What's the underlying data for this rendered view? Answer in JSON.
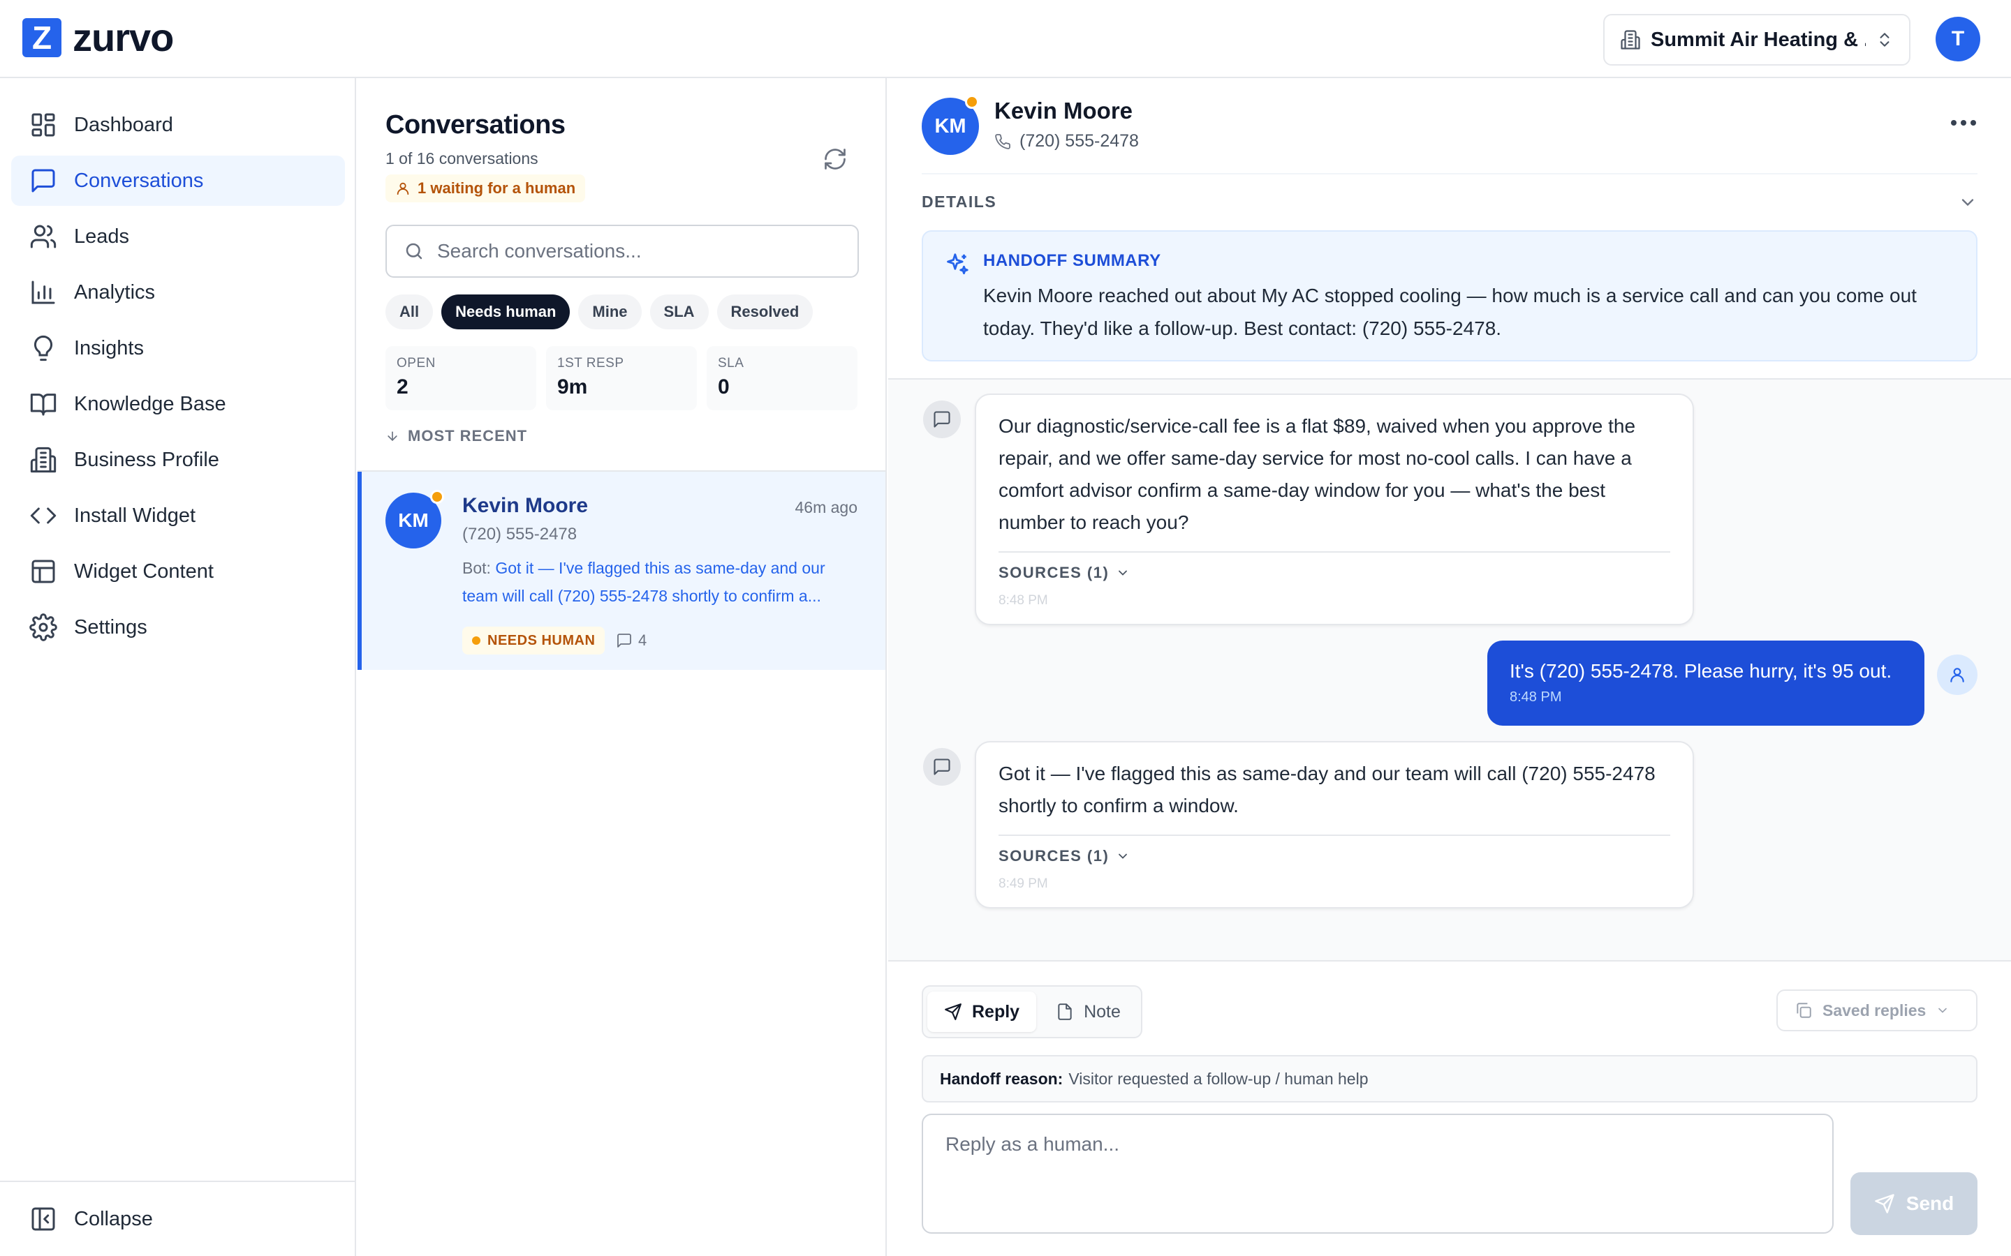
{
  "app": {
    "logo_letter": "Z",
    "logo_text": "zurvo",
    "business_name": "Summit Air Heating & ...",
    "user_initial": "T"
  },
  "sidebar": {
    "items": [
      {
        "label": "Dashboard",
        "icon": "dashboard-icon"
      },
      {
        "label": "Conversations",
        "icon": "chat-icon",
        "active": true
      },
      {
        "label": "Leads",
        "icon": "users-icon"
      },
      {
        "label": "Analytics",
        "icon": "bar-chart-icon"
      },
      {
        "label": "Insights",
        "icon": "lightbulb-icon"
      },
      {
        "label": "Knowledge Base",
        "icon": "book-icon"
      },
      {
        "label": "Business Profile",
        "icon": "building-icon"
      },
      {
        "label": "Install Widget",
        "icon": "code-icon"
      },
      {
        "label": "Widget Content",
        "icon": "layout-icon"
      },
      {
        "label": "Settings",
        "icon": "gear-icon"
      }
    ],
    "collapse_label": "Collapse"
  },
  "conversations": {
    "title": "Conversations",
    "count_text": "1 of 16 conversations",
    "waiting_text": "1 waiting for a human",
    "search_placeholder": "Search conversations...",
    "filters": [
      "All",
      "Needs human",
      "Mine",
      "SLA",
      "Resolved"
    ],
    "active_filter": "Needs human",
    "stats": [
      {
        "label": "OPEN",
        "value": "2"
      },
      {
        "label": "1ST RESP",
        "value": "9m"
      },
      {
        "label": "SLA",
        "value": "0"
      }
    ],
    "sort_label": "MOST RECENT",
    "items": [
      {
        "initials": "KM",
        "name": "Kevin Moore",
        "time": "46m ago",
        "phone": "(720) 555-2478",
        "preview_prefix": "Bot:",
        "preview_line1": "Got it — I've flagged this as same-day and our",
        "preview_line2": "team will call (720) 555-2478 shortly to confirm a...",
        "badge": "NEEDS HUMAN",
        "message_count": "4"
      }
    ]
  },
  "detail": {
    "initials": "KM",
    "name": "Kevin Moore",
    "phone": "(720) 555-2478",
    "details_label": "DETAILS",
    "handoff_title": "HANDOFF SUMMARY",
    "handoff_text": "Kevin Moore reached out about My AC stopped cooling — how much is a service call and can you come out today. They'd like a follow-up. Best contact: (720) 555-2478.",
    "messages": [
      {
        "from": "bot",
        "text": "Our diagnostic/service-call fee is a flat $89, waived when you approve the repair, and we offer same-day service for most no-cool calls. I can have a comfort advisor confirm a same-day window for you — what's the best number to reach you?",
        "sources": "SOURCES (1)",
        "time": "8:48 PM"
      },
      {
        "from": "visitor",
        "text": "It's (720) 555-2478. Please hurry, it's 95 out.",
        "time": "8:48 PM"
      },
      {
        "from": "bot",
        "text": "Got it — I've flagged this as same-day and our team will call (720) 555-2478 shortly to confirm a window.",
        "sources": "SOURCES (1)",
        "time": "8:49 PM"
      }
    ]
  },
  "composer": {
    "tab_reply": "Reply",
    "tab_note": "Note",
    "saved_replies": "Saved replies",
    "handoff_reason_label": "Handoff reason:",
    "handoff_reason_text": "Visitor requested a follow-up / human help",
    "reply_placeholder": "Reply as a human...",
    "send_label": "Send"
  },
  "colors": {
    "brand": "#2563eb",
    "active_nav_bg": "#eff6ff",
    "warning": "#b45309",
    "warning_dot": "#f59e0b"
  }
}
